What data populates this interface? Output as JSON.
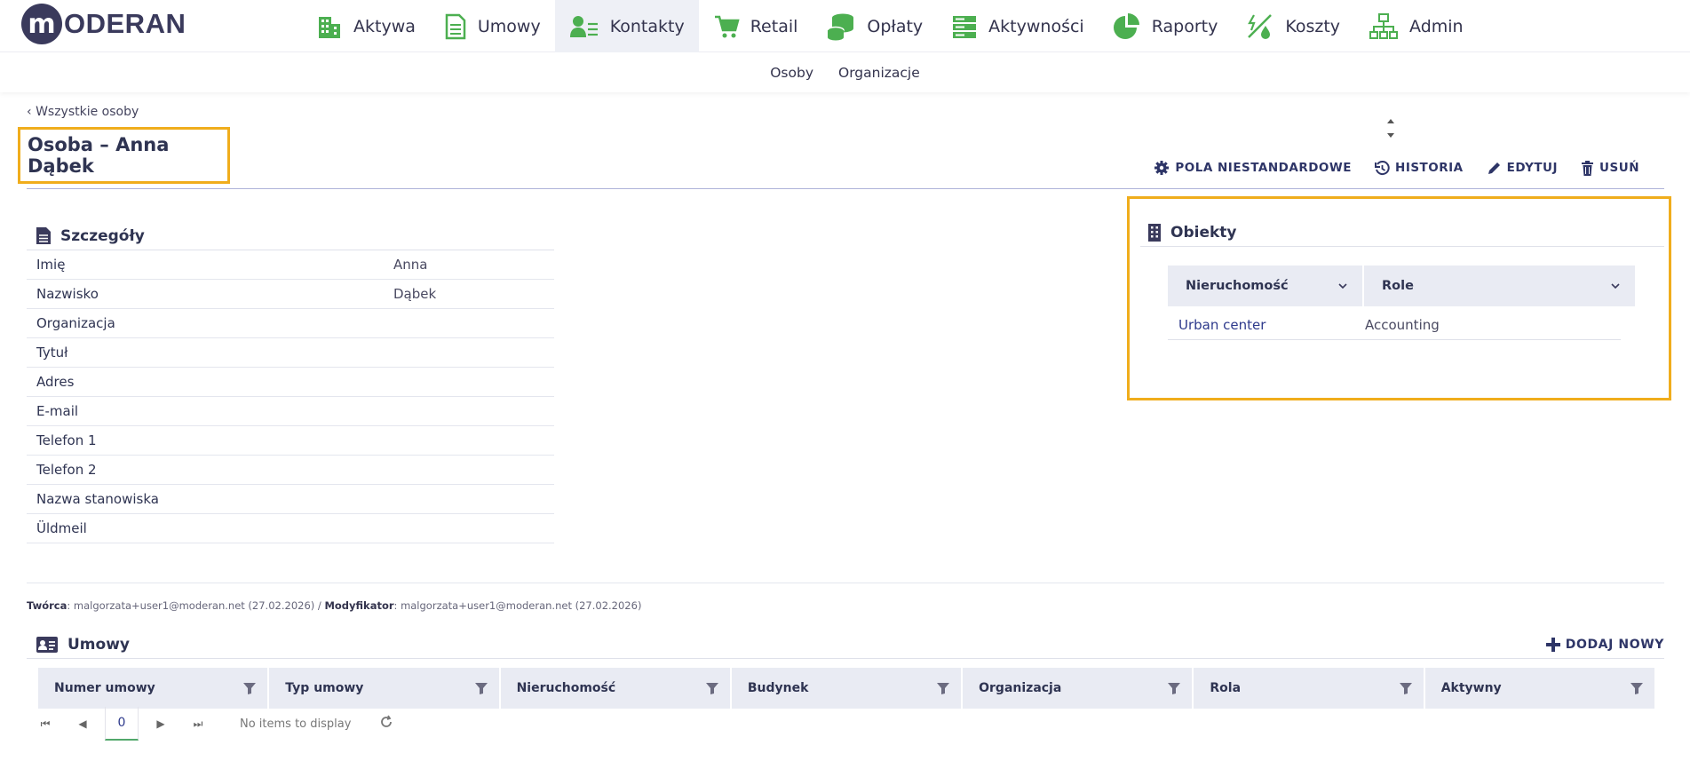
{
  "brand": {
    "logo_letter": "m",
    "logo_text": "ODERAN"
  },
  "nav": [
    {
      "label": "Aktywa",
      "icon": "building-icon",
      "active": false
    },
    {
      "label": "Umowy",
      "icon": "document-icon",
      "active": false
    },
    {
      "label": "Kontakty",
      "icon": "contacts-icon",
      "active": true
    },
    {
      "label": "Retail",
      "icon": "cart-icon",
      "active": false
    },
    {
      "label": "Opłaty",
      "icon": "coins-icon",
      "active": false
    },
    {
      "label": "Aktywności",
      "icon": "server-icon",
      "active": false
    },
    {
      "label": "Raporty",
      "icon": "pie-chart-icon",
      "active": false
    },
    {
      "label": "Koszty",
      "icon": "utilities-icon",
      "active": false
    },
    {
      "label": "Admin",
      "icon": "sitemap-icon",
      "active": false
    }
  ],
  "subnav": [
    "Osoby",
    "Organizacje"
  ],
  "breadcrumb": {
    "back_label": "Wszystkie osoby"
  },
  "page": {
    "title": "Osoba – Anna Dąbek"
  },
  "actions": {
    "custom_fields": "POLA NIESTANDARDOWE",
    "history": "HISTORIA",
    "edit": "EDYTUJ",
    "delete": "USUŃ"
  },
  "details": {
    "title": "Szczegóły",
    "rows": [
      {
        "label": "Imię",
        "value": "Anna"
      },
      {
        "label": "Nazwisko",
        "value": "Dąbek"
      },
      {
        "label": "Organizacja",
        "value": ""
      },
      {
        "label": "Tytuł",
        "value": ""
      },
      {
        "label": "Adres",
        "value": ""
      },
      {
        "label": "E-mail",
        "value": ""
      },
      {
        "label": "Telefon 1",
        "value": ""
      },
      {
        "label": "Telefon 2",
        "value": ""
      },
      {
        "label": "Nazwa stanowiska",
        "value": ""
      },
      {
        "label": "Üldmeil",
        "value": ""
      }
    ]
  },
  "objects": {
    "title": "Obiekty",
    "columns": [
      "Nieruchomość",
      "Role"
    ],
    "rows": [
      {
        "property": "Urban center",
        "role": "Accounting"
      }
    ]
  },
  "meta": {
    "creator_label": "Twórca",
    "creator_value": "malgorzata+user1@moderan.net (27.02.2026)",
    "separator": " / ",
    "modifier_label": "Modyfikator",
    "modifier_value": "malgorzata+user1@moderan.net (27.02.2026)"
  },
  "contracts": {
    "title": "Umowy",
    "add_label": "DODAJ NOWY",
    "columns": [
      "Numer umowy",
      "Typ umowy",
      "Nieruchomość",
      "Budynek",
      "Organizacja",
      "Rola",
      "Aktywny"
    ],
    "pager": {
      "page": "0",
      "empty_text": "No items to display"
    }
  },
  "colors": {
    "accent": "#4caf50",
    "highlight": "#f0ad1c",
    "primary": "#2e3567"
  }
}
